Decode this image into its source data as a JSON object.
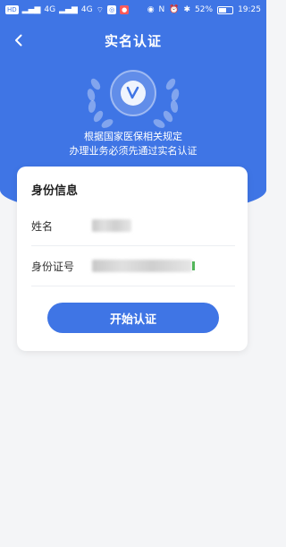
{
  "status_bar": {
    "left_badges": [
      "HD",
      "4G",
      "4G"
    ],
    "battery": "52%",
    "time": "19:25",
    "colors": {
      "bg": "#3f75e5",
      "fg": "#ffffff"
    }
  },
  "nav": {
    "title": "实名认证",
    "back_icon": "chevron-left-icon"
  },
  "hero": {
    "emblem_icon": "verified-badge-icon",
    "line1": "根据国家医保相关规定",
    "line2": "办理业务必须先通过实名认证"
  },
  "card": {
    "title": "身份信息",
    "name_label": "姓名",
    "id_label": "身份证号"
  },
  "action": {
    "button_label": "开始认证"
  },
  "theme": {
    "accent": "#3f75e5",
    "page_bg": "#f4f5f7",
    "card_bg": "#ffffff"
  }
}
